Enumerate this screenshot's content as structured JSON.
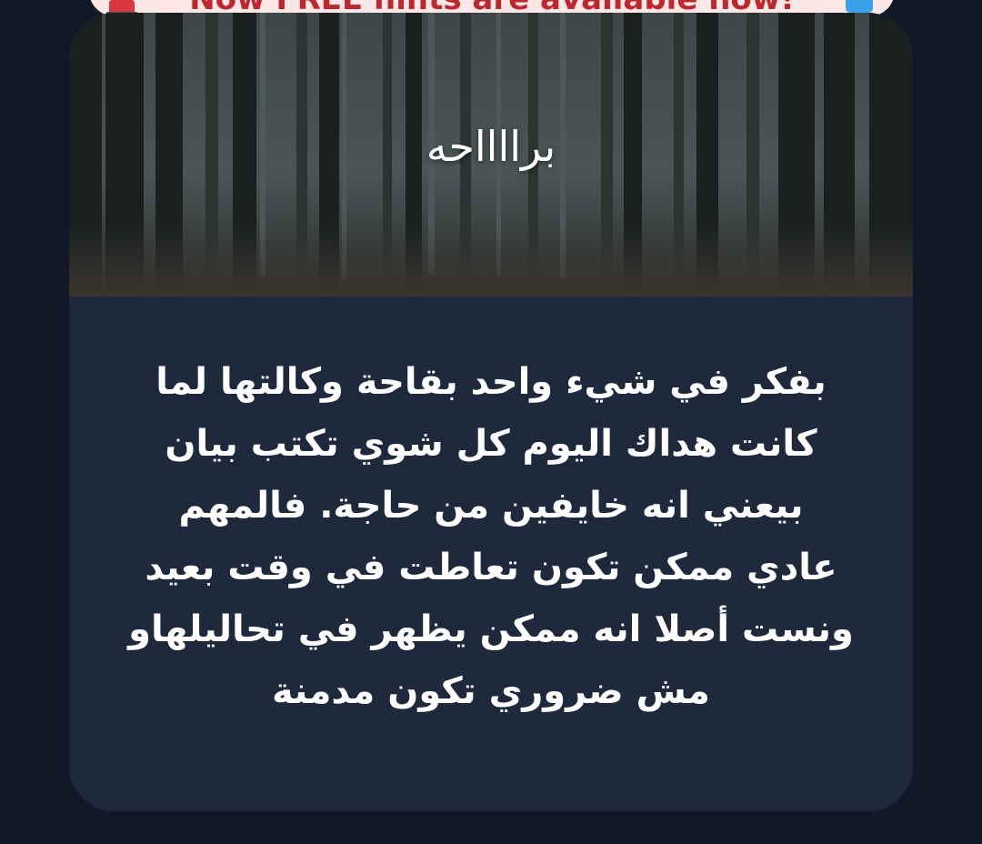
{
  "banner": {
    "text": "Now FREE hints are available now!",
    "left_icon": "siren-icon",
    "right_icon": "arrow-icon"
  },
  "card": {
    "title": "برااااحه",
    "image_icon": "misty-forest-image",
    "body_lines": [
      "بفكر في شيء واحد بقاحة وكالتها لما",
      "كانت هداك اليوم كل شوي تكتب بيان",
      "بيعني انه خايفين من حاجة. فالمهم",
      "عادي ممكن تكون تعاطت في وقت بعيد",
      "ونست أصلا انه ممكن يظهر في تحاليلهاو",
      "مش ضروري تكون مدمنة"
    ]
  },
  "colors": {
    "page_background": "#111827",
    "card_body": "#1e293b",
    "banner_background": "#fde8e8",
    "banner_text": "#c0262d"
  }
}
